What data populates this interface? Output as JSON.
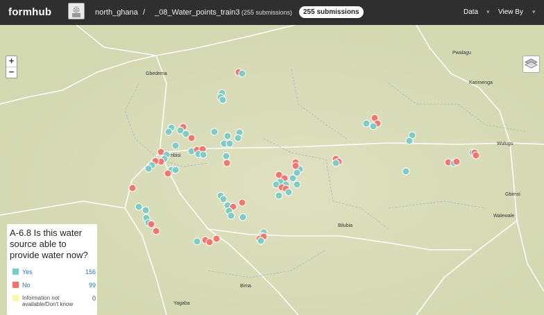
{
  "header": {
    "logo": "formhub",
    "user": "north_ghana",
    "separator": "/",
    "form": "_08_Water_points_train3",
    "submissions_text": "(255 submissions)",
    "submissions_pill": "255 submissions",
    "menu": [
      {
        "label": "Data",
        "caret": "▾"
      },
      {
        "label": "View By",
        "caret": "▾"
      }
    ],
    "avatar_icon": "user-avatar-icon"
  },
  "map": {
    "zoom_in": "+",
    "zoom_out": "−",
    "places": [
      {
        "name": "Pwalagu"
      },
      {
        "name": "Gbedema"
      },
      {
        "name": "Karimenga"
      },
      {
        "name": "Wulugu"
      },
      {
        "name": "Gbimsi"
      },
      {
        "name": "Walewale"
      },
      {
        "name": "Bilubia"
      },
      {
        "name": "Bima"
      },
      {
        "name": "Yagaba"
      },
      {
        "name": "Fumbisi"
      }
    ]
  },
  "legend": {
    "question": "A-6.8 Is this water source able to provide water now?",
    "items": [
      {
        "label": "Yes",
        "count": "156",
        "color": "#7ccbc6"
      },
      {
        "label": "No",
        "count": "99",
        "color": "#f1736b"
      },
      {
        "label": "Information not available/Don't know",
        "count": "0",
        "color": "#fdf6a8"
      }
    ]
  },
  "colors": {
    "yes": "#7ccbc6",
    "no": "#f1736b",
    "topbar": "#2f2f2f",
    "map_bg": "#d7dbb8"
  }
}
